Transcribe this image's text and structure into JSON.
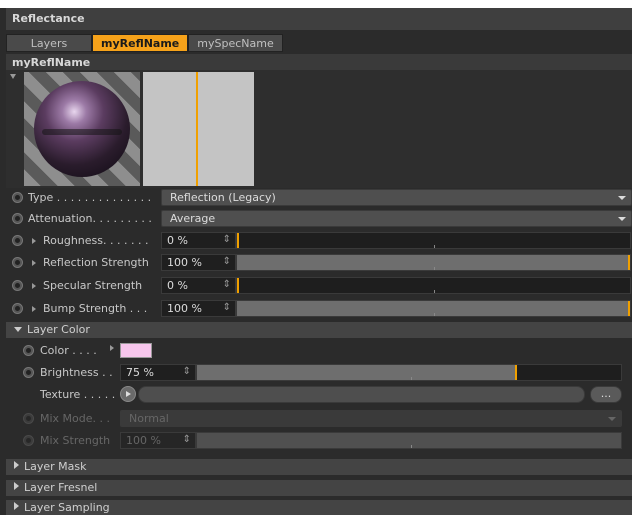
{
  "panel": {
    "title": "Reflectance"
  },
  "tabs": [
    {
      "label": "Layers"
    },
    {
      "label": "myReflName"
    },
    {
      "label": "mySpecName"
    }
  ],
  "section": {
    "title": "myReflName"
  },
  "params": {
    "type": {
      "label": "Type . . . . . . . . . . . . . .",
      "value": "Reflection (Legacy)"
    },
    "attenuation": {
      "label": "Attenuation. . . . . . . . .",
      "value": "Average"
    },
    "roughness": {
      "label": "Roughness. . . . . . .",
      "value": "0 %",
      "level": 0
    },
    "reflection_strength": {
      "label": "Reflection Strength",
      "value": "100 %",
      "level": 1.0
    },
    "specular_strength": {
      "label": "Specular Strength",
      "value": "0 %",
      "level": 0
    },
    "bump_strength": {
      "label": "Bump Strength . . .",
      "value": "100 %",
      "level": 1.0
    }
  },
  "layer_color": {
    "title": "Layer Color",
    "color": {
      "label": "Color . . . .",
      "value": "#f7c6ec"
    },
    "brightness": {
      "label": "Brightness . .",
      "value": "75 %",
      "level": 0.75
    },
    "texture": {
      "label": "Texture . . . . .",
      "more": "..."
    },
    "mix_mode": {
      "label": "Mix Mode. . .",
      "value": "Normal"
    },
    "mix_strength": {
      "label": "Mix Strength",
      "value": "100 %",
      "level": 1.0
    }
  },
  "collapsed": [
    {
      "label": "Layer Mask"
    },
    {
      "label": "Layer Fresnel"
    },
    {
      "label": "Layer Sampling"
    }
  ],
  "colors": {
    "accent": "#f6a21a",
    "swatch": "#f7c6ec"
  }
}
